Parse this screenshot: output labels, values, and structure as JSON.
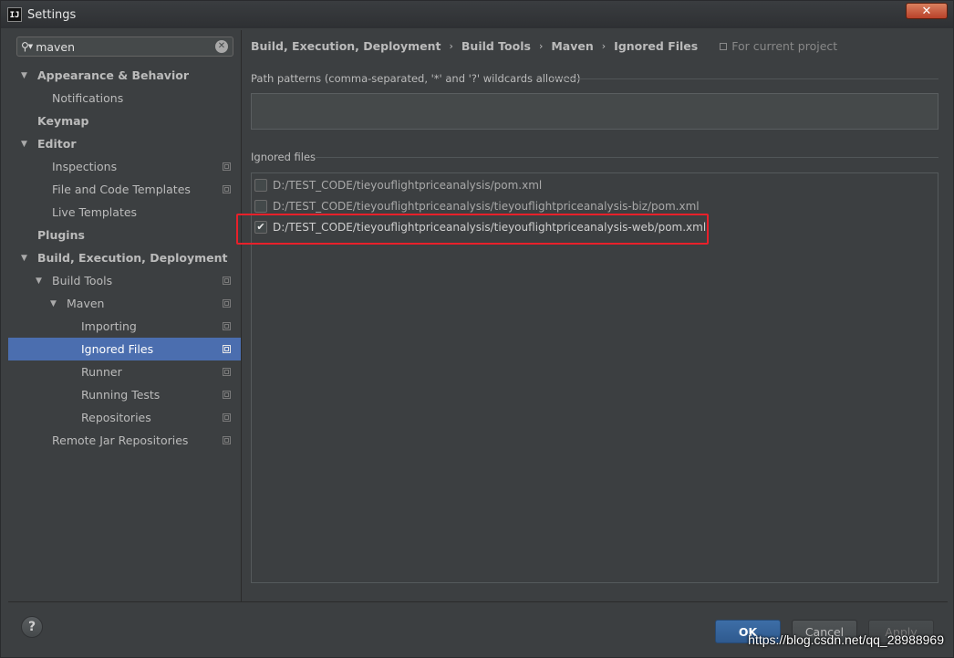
{
  "window": {
    "title": "Settings",
    "app_icon_text": "IJ",
    "close_glyph": "✕"
  },
  "search": {
    "value": "maven",
    "placeholder": ""
  },
  "sidebar": {
    "items": [
      {
        "label": "Appearance & Behavior",
        "level": 0,
        "arrow": "▼",
        "bold": true,
        "project": false,
        "selected": false
      },
      {
        "label": "Notifications",
        "level": 1,
        "arrow": "",
        "bold": false,
        "project": false,
        "selected": false
      },
      {
        "label": "Keymap",
        "level": 0,
        "arrow": "",
        "bold": true,
        "project": false,
        "selected": false
      },
      {
        "label": "Editor",
        "level": 0,
        "arrow": "▼",
        "bold": true,
        "project": false,
        "selected": false
      },
      {
        "label": "Inspections",
        "level": 1,
        "arrow": "",
        "bold": false,
        "project": true,
        "selected": false
      },
      {
        "label": "File and Code Templates",
        "level": 1,
        "arrow": "",
        "bold": false,
        "project": true,
        "selected": false
      },
      {
        "label": "Live Templates",
        "level": 1,
        "arrow": "",
        "bold": false,
        "project": false,
        "selected": false
      },
      {
        "label": "Plugins",
        "level": 0,
        "arrow": "",
        "bold": true,
        "project": false,
        "selected": false
      },
      {
        "label": "Build, Execution, Deployment",
        "level": 0,
        "arrow": "▼",
        "bold": true,
        "project": false,
        "selected": false
      },
      {
        "label": "Build Tools",
        "level": 1,
        "arrow": "▼",
        "bold": false,
        "project": true,
        "selected": false
      },
      {
        "label": "Maven",
        "level": 2,
        "arrow": "▼",
        "bold": false,
        "project": true,
        "selected": false
      },
      {
        "label": "Importing",
        "level": 3,
        "arrow": "",
        "bold": false,
        "project": true,
        "selected": false
      },
      {
        "label": "Ignored Files",
        "level": 3,
        "arrow": "",
        "bold": false,
        "project": true,
        "selected": true
      },
      {
        "label": "Runner",
        "level": 3,
        "arrow": "",
        "bold": false,
        "project": true,
        "selected": false
      },
      {
        "label": "Running Tests",
        "level": 3,
        "arrow": "",
        "bold": false,
        "project": true,
        "selected": false
      },
      {
        "label": "Repositories",
        "level": 3,
        "arrow": "",
        "bold": false,
        "project": true,
        "selected": false
      },
      {
        "label": "Remote Jar Repositories",
        "level": 1,
        "arrow": "",
        "bold": false,
        "project": true,
        "selected": false
      }
    ]
  },
  "breadcrumb": {
    "items": [
      "Build, Execution, Deployment",
      "Build Tools",
      "Maven",
      "Ignored Files"
    ],
    "separator": "›",
    "scope": "For current project"
  },
  "patterns": {
    "title": "Path patterns (comma-separated, '*' and '?' wildcards allowed)",
    "value": ""
  },
  "ignored_files": {
    "title": "Ignored files",
    "files": [
      {
        "path": "D:/TEST_CODE/tieyouflightpriceanalysis/pom.xml",
        "checked": false
      },
      {
        "path": "D:/TEST_CODE/tieyouflightpriceanalysis/tieyouflightpriceanalysis-biz/pom.xml",
        "checked": false
      },
      {
        "path": "D:/TEST_CODE/tieyouflightpriceanalysis/tieyouflightpriceanalysis-web/pom.xml",
        "checked": true
      }
    ]
  },
  "footer": {
    "help": "?",
    "ok": "OK",
    "cancel": "Cancel",
    "apply": "Apply"
  },
  "watermark": "https://blog.csdn.net/qq_28988969",
  "colors": {
    "selection": "#4b6eaf",
    "highlight": "#e8202a",
    "ok_button": "#3d6ea7"
  }
}
